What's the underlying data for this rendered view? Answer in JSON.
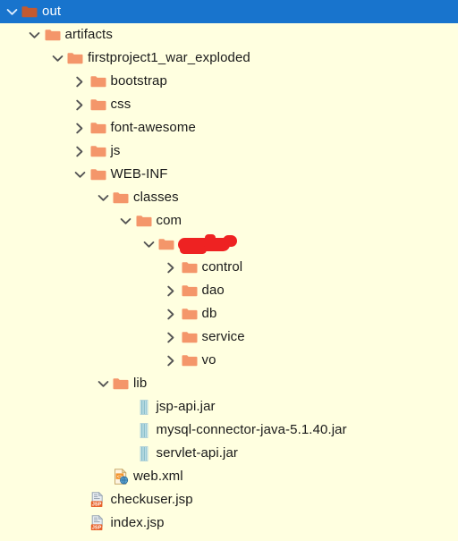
{
  "panel": {
    "name": "project-file-tree",
    "background_color": "#FFFFE0",
    "selection_color": "#1874CD",
    "folder_color": "#F4966A",
    "text_color": "#1A1A1A",
    "redaction_color": "#EE2222"
  },
  "tree": [
    {
      "label": "out",
      "depth": 0,
      "type": "folder",
      "state": "expanded",
      "selected": true,
      "redacted": false
    },
    {
      "label": "artifacts",
      "depth": 1,
      "type": "folder",
      "state": "expanded",
      "selected": false,
      "redacted": false
    },
    {
      "label": "firstproject1_war_exploded",
      "depth": 2,
      "type": "folder",
      "state": "expanded",
      "selected": false,
      "redacted": false
    },
    {
      "label": "bootstrap",
      "depth": 3,
      "type": "folder",
      "state": "collapsed",
      "selected": false,
      "redacted": false
    },
    {
      "label": "css",
      "depth": 3,
      "type": "folder",
      "state": "collapsed",
      "selected": false,
      "redacted": false
    },
    {
      "label": "font-awesome",
      "depth": 3,
      "type": "folder",
      "state": "collapsed",
      "selected": false,
      "redacted": false
    },
    {
      "label": "js",
      "depth": 3,
      "type": "folder",
      "state": "collapsed",
      "selected": false,
      "redacted": false
    },
    {
      "label": "WEB-INF",
      "depth": 3,
      "type": "folder",
      "state": "expanded",
      "selected": false,
      "redacted": false
    },
    {
      "label": "classes",
      "depth": 4,
      "type": "folder",
      "state": "expanded",
      "selected": false,
      "redacted": false
    },
    {
      "label": "com",
      "depth": 5,
      "type": "folder",
      "state": "expanded",
      "selected": false,
      "redacted": false
    },
    {
      "label": "",
      "depth": 6,
      "type": "folder",
      "state": "expanded",
      "selected": false,
      "redacted": true
    },
    {
      "label": "control",
      "depth": 7,
      "type": "folder",
      "state": "collapsed",
      "selected": false,
      "redacted": false
    },
    {
      "label": "dao",
      "depth": 7,
      "type": "folder",
      "state": "collapsed",
      "selected": false,
      "redacted": false
    },
    {
      "label": "db",
      "depth": 7,
      "type": "folder",
      "state": "collapsed",
      "selected": false,
      "redacted": false
    },
    {
      "label": "service",
      "depth": 7,
      "type": "folder",
      "state": "collapsed",
      "selected": false,
      "redacted": false
    },
    {
      "label": "vo",
      "depth": 7,
      "type": "folder",
      "state": "collapsed",
      "selected": false,
      "redacted": false
    },
    {
      "label": "lib",
      "depth": 4,
      "type": "folder",
      "state": "expanded",
      "selected": false,
      "redacted": false
    },
    {
      "label": "jsp-api.jar",
      "depth": 5,
      "type": "jar",
      "state": "leaf",
      "selected": false,
      "redacted": false
    },
    {
      "label": "mysql-connector-java-5.1.40.jar",
      "depth": 5,
      "type": "jar",
      "state": "leaf",
      "selected": false,
      "redacted": false
    },
    {
      "label": "servlet-api.jar",
      "depth": 5,
      "type": "jar",
      "state": "leaf",
      "selected": false,
      "redacted": false
    },
    {
      "label": "web.xml",
      "depth": 4,
      "type": "xml",
      "state": "leaf",
      "selected": false,
      "redacted": false
    },
    {
      "label": "checkuser.jsp",
      "depth": 3,
      "type": "jsp",
      "state": "leaf",
      "selected": false,
      "redacted": false
    },
    {
      "label": "index.jsp",
      "depth": 3,
      "type": "jsp",
      "state": "leaf",
      "selected": false,
      "redacted": false
    }
  ]
}
